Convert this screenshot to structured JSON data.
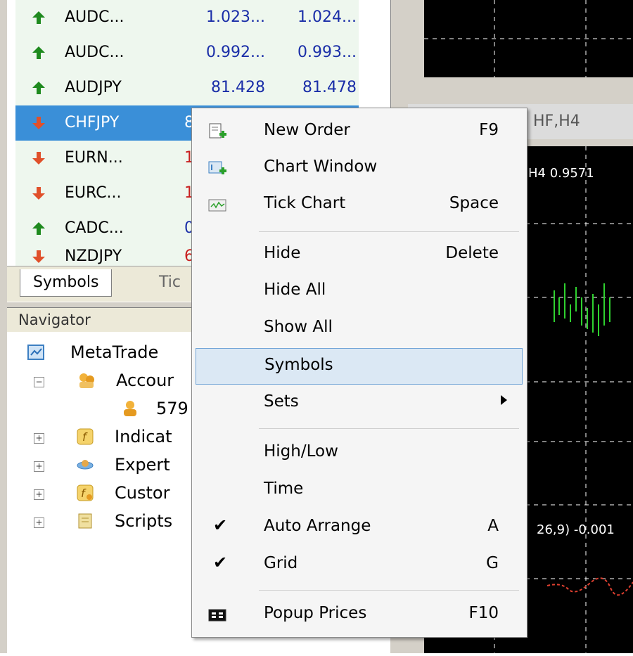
{
  "market_watch": {
    "rows": [
      {
        "symbol": "AUDC...",
        "bid": "1.023...",
        "ask": "1.024...",
        "dir": "up"
      },
      {
        "symbol": "AUDC...",
        "bid": "0.992...",
        "ask": "0.993...",
        "dir": "up"
      },
      {
        "symbol": "AUDJPY",
        "bid": "81.428",
        "ask": "81.478",
        "dir": "up"
      },
      {
        "symbol": "CHFJPY",
        "bid": "8",
        "ask": "",
        "dir": "down",
        "selected": true
      },
      {
        "symbol": "EURN...",
        "bid": "1.",
        "ask": "",
        "dir": "down"
      },
      {
        "symbol": "EURC...",
        "bid": "1.",
        "ask": "",
        "dir": "down"
      },
      {
        "symbol": "CADC...",
        "bid": "0.",
        "ask": "",
        "dir": "up"
      },
      {
        "symbol": "NZDJPY",
        "bid": "6",
        "ask": "",
        "dir": "down"
      }
    ],
    "tabs": [
      "Symbols",
      "Tic"
    ]
  },
  "navigator": {
    "title": "Navigator",
    "items": [
      {
        "label": "MetaTrade",
        "icon": "metatrader-icon"
      },
      {
        "label": "Accour",
        "icon": "accounts-icon"
      },
      {
        "label": "579",
        "icon": "account-user-icon"
      },
      {
        "label": "Indicat",
        "icon": "indicators-icon"
      },
      {
        "label": "Expert",
        "icon": "expert-advisors-icon"
      },
      {
        "label": "Custor",
        "icon": "custom-indicators-icon"
      },
      {
        "label": "Scripts",
        "icon": "scripts-icon"
      }
    ]
  },
  "chart": {
    "title": "HF,H4",
    "info": "H4  0.9571",
    "indicator": "26,9) -0.001"
  },
  "context_menu": {
    "items": [
      {
        "label": "New Order",
        "key": "F9",
        "icon": "new-order-icon"
      },
      {
        "label": "Chart Window",
        "key": "",
        "icon": "chart-window-icon"
      },
      {
        "label": "Tick Chart",
        "key": "Space",
        "icon": "tick-chart-icon"
      },
      {
        "label": "Hide",
        "key": "Delete"
      },
      {
        "label": "Hide All",
        "key": ""
      },
      {
        "label": "Show All",
        "key": ""
      },
      {
        "label": "Symbols",
        "key": "",
        "highlighted": true
      },
      {
        "label": "Sets",
        "key": "",
        "submenu": true
      },
      {
        "label": "High/Low",
        "key": ""
      },
      {
        "label": "Time",
        "key": ""
      },
      {
        "label": "Auto Arrange",
        "key": "A",
        "checked": true
      },
      {
        "label": "Grid",
        "key": "G",
        "checked": true
      },
      {
        "label": "Popup Prices",
        "key": "F10",
        "icon": "popup-prices-icon"
      }
    ]
  },
  "colors": {
    "up": "#1e8a1e",
    "down": "#e0502a",
    "selected": "#3a8fd8",
    "bid_up": "#1a2ea8",
    "bid_down": "#c81e1e"
  }
}
